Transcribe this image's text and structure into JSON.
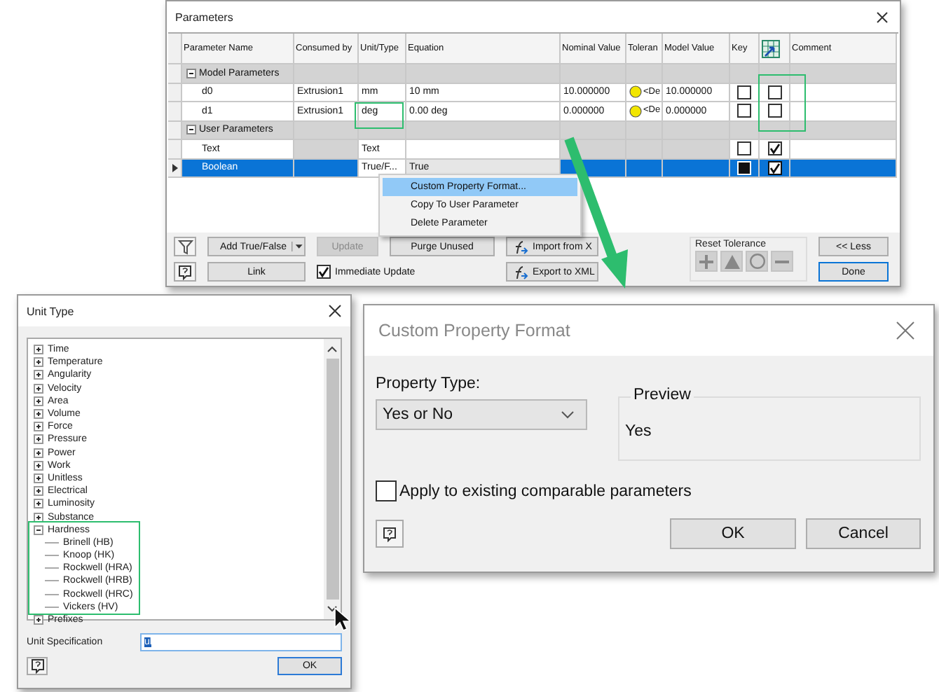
{
  "parameters_window": {
    "title": "Parameters",
    "columns": [
      {
        "kind": "text",
        "label": "Parameter Name"
      },
      {
        "kind": "text",
        "label": "Consumed by"
      },
      {
        "kind": "text",
        "label": "Unit/Type"
      },
      {
        "kind": "text",
        "label": "Equation"
      },
      {
        "kind": "text",
        "label": "Nominal Value"
      },
      {
        "kind": "text",
        "label": "Toleran"
      },
      {
        "kind": "text",
        "label": "Model Value"
      },
      {
        "kind": "text",
        "label": "Key"
      },
      {
        "kind": "icon"
      },
      {
        "kind": "text",
        "label": "Comment"
      }
    ],
    "groups": [
      {
        "label": "Model Parameters",
        "expanded": true,
        "rows": [
          {
            "name": "d0",
            "consumed_by": "Extrusion1",
            "unit": "mm",
            "equation": "10 mm",
            "nominal_value": "10.000000",
            "tolerance": "<De",
            "model_value": "10.000000",
            "key": false,
            "export": false,
            "selected": false
          },
          {
            "name": "d1",
            "consumed_by": "Extrusion1",
            "unit": "deg",
            "equation": "0.00 deg",
            "nominal_value": "0.000000",
            "tolerance": "<De",
            "model_value": "0.000000",
            "key": false,
            "export": false,
            "selected": false
          }
        ]
      },
      {
        "label": "User Parameters",
        "expanded": true,
        "rows": [
          {
            "name": "Text",
            "unit": "Text",
            "key": false,
            "export": true,
            "selected": false
          },
          {
            "name": "Boolean",
            "unit": "True/F...",
            "equation": "True",
            "key": false,
            "export": true,
            "selected": true
          }
        ]
      }
    ],
    "context_menu": [
      {
        "label": "Custom Property Format...",
        "selected": true
      },
      {
        "label": "Copy To User Parameter",
        "selected": false
      },
      {
        "label": "Delete Parameter",
        "selected": false
      }
    ],
    "buttons": [
      {
        "kind": "add",
        "label": "Add True/False",
        "disabled": false
      },
      {
        "kind": "update",
        "label": "Update",
        "disabled": true
      },
      {
        "kind": "purge",
        "label": "Purge Unused",
        "disabled": false
      },
      {
        "kind": "import",
        "label": "Import from X",
        "disabled": false
      },
      {
        "kind": "less",
        "label": "<< Less",
        "disabled": false
      },
      {
        "kind": "link",
        "label": "Link",
        "disabled": false
      },
      {
        "kind": "export",
        "label": "Export to XML",
        "disabled": false
      },
      {
        "kind": "done",
        "label": "Done",
        "disabled": false
      }
    ],
    "immediate_update": {
      "label": "Immediate Update",
      "checked": true
    },
    "reset_tolerance": {
      "title": "Reset Tolerance"
    }
  },
  "unit_type_window": {
    "title": "Unit Type",
    "tree": [
      {
        "label": "Time",
        "expanded": false
      },
      {
        "label": "Temperature",
        "expanded": false
      },
      {
        "label": "Angularity",
        "expanded": false
      },
      {
        "label": "Velocity",
        "expanded": false
      },
      {
        "label": "Area",
        "expanded": false
      },
      {
        "label": "Volume",
        "expanded": false
      },
      {
        "label": "Force",
        "expanded": false
      },
      {
        "label": "Pressure",
        "expanded": false
      },
      {
        "label": "Power",
        "expanded": false
      },
      {
        "label": "Work",
        "expanded": false
      },
      {
        "label": "Unitless",
        "expanded": false
      },
      {
        "label": "Electrical",
        "expanded": false
      },
      {
        "label": "Luminosity",
        "expanded": false
      },
      {
        "label": "Substance",
        "expanded": false
      },
      {
        "label": "Hardness",
        "expanded": true,
        "children": [
          {
            "label": "Brinell (HB)"
          },
          {
            "label": "Knoop (HK)"
          },
          {
            "label": "Rockwell (HRA)"
          },
          {
            "label": "Rockwell (HRB)"
          },
          {
            "label": "Rockwell (HRC)"
          },
          {
            "label": "Vickers (HV)"
          }
        ]
      },
      {
        "label": "Prefixes",
        "expanded": false
      }
    ],
    "unit_specification": {
      "label": "Unit Specification",
      "value": "ul"
    },
    "ok": "OK"
  },
  "custom_property_format": {
    "title": "Custom Property Format",
    "property_type": {
      "label": "Property Type:",
      "value": "Yes or No"
    },
    "preview": {
      "title": "Preview",
      "value": "Yes"
    },
    "apply": {
      "label": "Apply to existing comparable parameters",
      "checked": false
    },
    "buttons": [
      "OK",
      "Cancel"
    ]
  }
}
